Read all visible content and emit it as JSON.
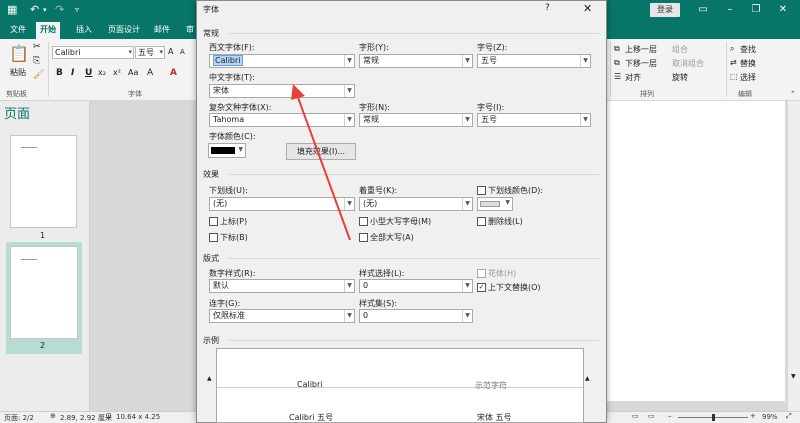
{
  "app": {
    "login": "登录",
    "tabs": [
      "文件",
      "开始",
      "插入",
      "页面设计",
      "邮件",
      "审"
    ]
  },
  "ribbon": {
    "paste_label": "粘贴",
    "clipboard_label": "剪贴板",
    "font_name": "Calibri",
    "font_size": "五号",
    "font_group_label": "字体",
    "format_buttons": [
      "B",
      "I",
      "U",
      "x₂",
      "x²",
      "A",
      "A"
    ],
    "arrange": {
      "bring_forward": "上移一层",
      "send_backward": "下移一层",
      "align": "对齐",
      "group": "组合",
      "ungroup": "取消组合",
      "rotate": "旋转",
      "label": "排列"
    },
    "edit": {
      "find": "查找",
      "replace": "替换",
      "select": "选择",
      "label": "编辑"
    }
  },
  "nav": {
    "title": "页面",
    "pages": [
      "1",
      "2"
    ]
  },
  "status": {
    "page": "页面: 2/2",
    "position": "2.89, 2.92 厘米",
    "size": "10.64 x 4.25",
    "zoom": "99%"
  },
  "dialog": {
    "title": "字体",
    "help": "?",
    "close": "✕",
    "section_general": "常规",
    "western_font_label": "西文字体(F):",
    "western_font_value": "Calibri",
    "style_label": "字形(Y):",
    "style_value": "常规",
    "size_label": "字号(Z):",
    "size_value": "五号",
    "chinese_font_label": "中文字体(T):",
    "chinese_font_value": "宋体",
    "complex_font_label": "复杂文种字体(X):",
    "complex_font_value": "Tahoma",
    "complex_style_label": "字形(N):",
    "complex_style_value": "常规",
    "complex_size_label": "字号(I):",
    "complex_size_value": "五号",
    "color_label": "字体颜色(C):",
    "fill_effects_label": "填充效果(I)...",
    "section_effects": "效果",
    "underline_label": "下划线(U):",
    "underline_value": "(无)",
    "emphasis_label": "着重号(K):",
    "emphasis_value": "(无)",
    "underline_color_label": "下划线颜色(D):",
    "superscript": "上标(P)",
    "subscript": "下标(B)",
    "small_caps": "小型大写字母(M)",
    "all_caps": "全部大写(A)",
    "strikethrough": "删除线(L)",
    "section_typography": "版式",
    "numeral_style_label": "数字样式(R):",
    "numeral_style_value": "默认",
    "stylistic_alt_label": "样式选择(L):",
    "stylistic_alt_value": "0",
    "swash_label": "花体(H)",
    "contextual_alt_label": "上下文替换(O)",
    "ligatures_label": "连字(G):",
    "ligatures_value": "仅限标准",
    "stylistic_set_label": "样式集(S):",
    "stylistic_set_value": "0",
    "section_sample": "示例",
    "sample_left_1": "Calibri",
    "sample_right_1": "示范字符",
    "sample_left_2": "Calibri 五号",
    "sample_right_2": "宋体 五号"
  },
  "colors": {
    "brand": "#077568",
    "arrow": "#e5413a"
  }
}
